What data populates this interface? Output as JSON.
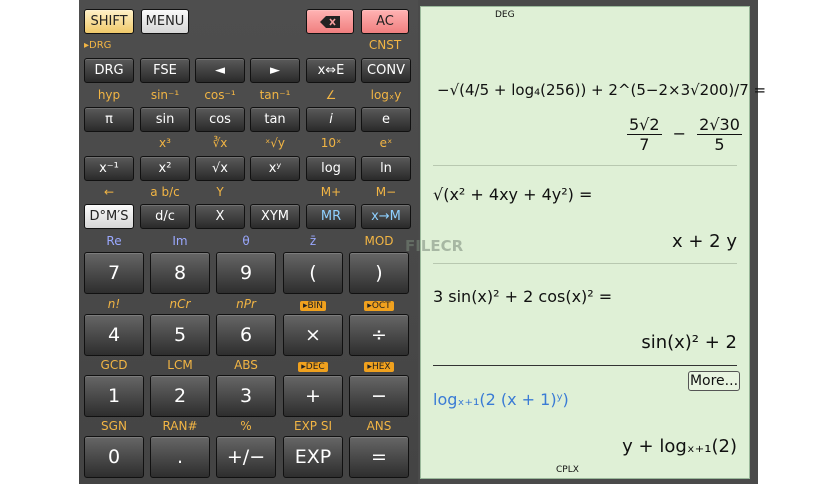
{
  "top_row": {
    "shift": "SHIFT",
    "menu": "MENU",
    "backspace_icon": "backspace-icon",
    "ac": "AC"
  },
  "rows": [
    {
      "labels": [
        "▸DRG",
        "",
        "",
        "",
        "",
        "CNST"
      ],
      "keys": [
        "DRG",
        "FSE",
        "◄",
        "►",
        "x⇔E",
        "CONV"
      ]
    },
    {
      "labels": [
        "hyp",
        "sin⁻¹",
        "cos⁻¹",
        "tan⁻¹",
        "∠",
        "logₓy"
      ],
      "keys": [
        "π",
        "sin",
        "cos",
        "tan",
        "i",
        "e"
      ]
    },
    {
      "labels": [
        "",
        "x³",
        "∛x",
        "ˣ√y",
        "10ˣ",
        "eˣ"
      ],
      "keys": [
        "x⁻¹",
        "x²",
        "√x",
        "xʸ",
        "log",
        "ln"
      ]
    },
    {
      "labels": [
        "←",
        "a b/c",
        "Y",
        "",
        "M+",
        "M−"
      ],
      "keys": [
        "D°M′S",
        "d/c",
        "X",
        "XYM",
        "MR",
        "x→M"
      ]
    },
    {
      "labels": [
        "Re",
        "Im",
        "θ",
        "z̄",
        "",
        "MOD"
      ],
      "keys": [
        "7",
        "8",
        "9",
        "(",
        ")"
      ]
    },
    {
      "labels": [
        "n!",
        "nCr",
        "nPr",
        "▸BIN",
        "▸OCT"
      ],
      "keys": [
        "4",
        "5",
        "6",
        "×",
        "÷"
      ]
    },
    {
      "labels": [
        "GCD",
        "LCM",
        "ABS",
        "▸DEC",
        "▸HEX"
      ],
      "keys": [
        "1",
        "2",
        "3",
        "+",
        "−"
      ]
    },
    {
      "labels": [
        "SGN",
        "RAN#",
        "%",
        "EXP SI",
        "ANS"
      ],
      "keys": [
        "0",
        ".",
        "+/−",
        "EXP",
        "="
      ]
    }
  ],
  "display": {
    "mode_top": "DEG",
    "mode_bottom": "CPLX",
    "expr1_text": "−√(4/5 + log₄(256)) + 2^(5−2×3√200)/7 =",
    "res1_a_num": "5√2",
    "res1_a_den": "7",
    "res1_minus": "−",
    "res1_b_num": "2√30",
    "res1_b_den": "5",
    "expr2": "√(x² + 4xy + 4y²) =",
    "res2": "x + 2 y",
    "expr3": "3 sin(x)² + 2 cos(x)² =",
    "res3": "sin(x)² + 2",
    "more": "More...",
    "expr4": "logₓ₊₁(2 (x + 1)ʸ)",
    "res4": "y + logₓ₊₁(2)",
    "watermark": "FILECR"
  },
  "colors": {
    "accent_label": "#f2b544",
    "blue_label": "#9aa8ff",
    "display_bg": "#dff0d6",
    "result_blue": "#3a7bd5"
  }
}
